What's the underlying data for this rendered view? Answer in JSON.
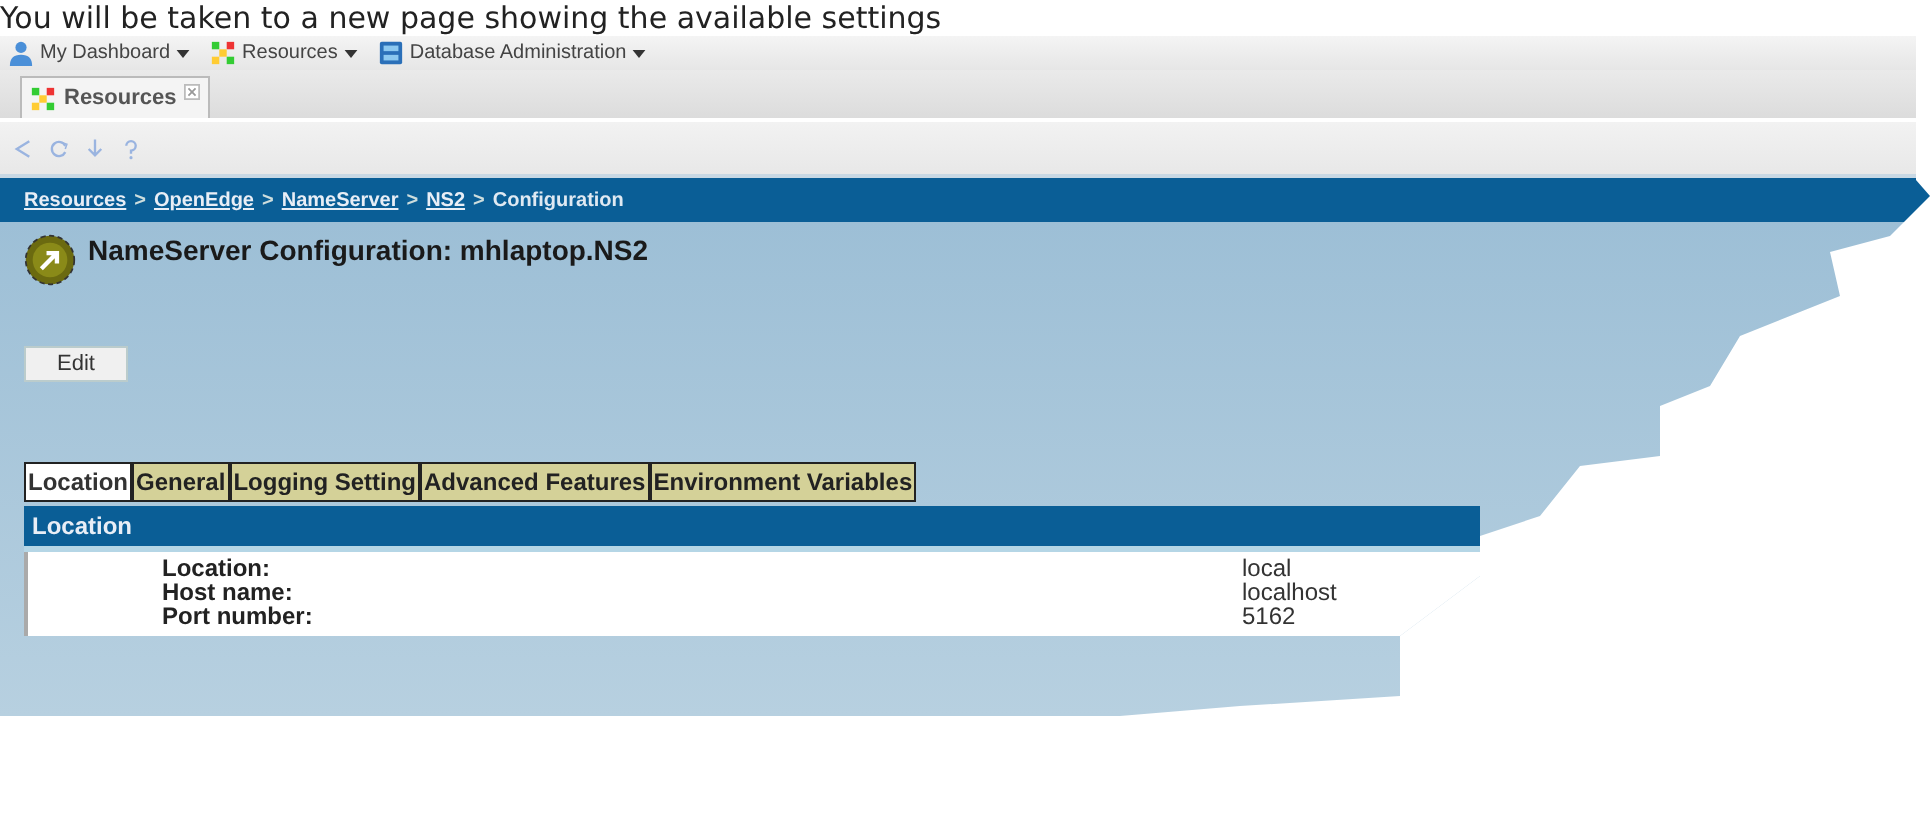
{
  "caption": "You will be taken to a new page showing the available settings",
  "menu": [
    {
      "label": "My Dashboard"
    },
    {
      "label": "Resources"
    },
    {
      "label": "Database Administration"
    }
  ],
  "tabs": [
    {
      "label": "Resources",
      "selected": true
    }
  ],
  "breadcrumb": {
    "separator": ">",
    "items": [
      {
        "label": "Resources",
        "link": true
      },
      {
        "label": "OpenEdge",
        "link": true
      },
      {
        "label": "NameServer",
        "link": true
      },
      {
        "label": "NS2",
        "link": true
      },
      {
        "label": "Configuration",
        "link": false
      }
    ]
  },
  "page_title": "NameServer Configuration: mhlaptop.NS2",
  "edit_button": "Edit",
  "section_tabs": [
    {
      "label": "Location",
      "selected": true
    },
    {
      "label": "General",
      "selected": false
    },
    {
      "label": "Logging Setting",
      "selected": false
    },
    {
      "label": "Advanced Features",
      "selected": false
    },
    {
      "label": "Environment Variables",
      "selected": false
    }
  ],
  "section": {
    "title": "Location",
    "rows": [
      {
        "label": "Location:",
        "value": "local"
      },
      {
        "label": "Host name:",
        "value": "localhost"
      },
      {
        "label": "Port number:",
        "value": "5162"
      }
    ]
  }
}
